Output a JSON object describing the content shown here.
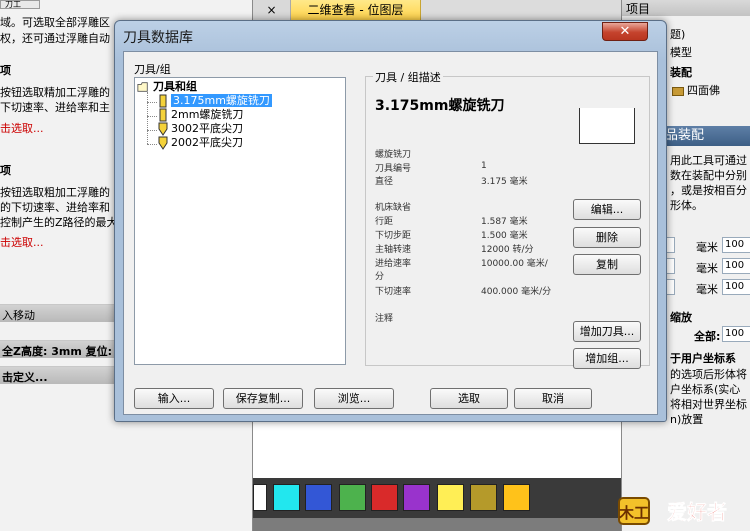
{
  "left_panel": {
    "top_button": "刀工",
    "lines": [
      {
        "text": "域。可选取全部浮雕区",
        "style": ""
      },
      {
        "text": "权，还可通过浮雕自动",
        "style": ""
      },
      {
        "text": "项",
        "style": "bold"
      },
      {
        "text": "按钮选取精加工浮雕的",
        "style": ""
      },
      {
        "text": "下切速率、进给率和主",
        "style": ""
      },
      {
        "text": "击选取...",
        "style": "red"
      },
      {
        "text": "项",
        "style": "bold"
      },
      {
        "text": "按钮选取粗加工浮雕的",
        "style": ""
      },
      {
        "text": "的下切速率、进给率和",
        "style": ""
      },
      {
        "text": "控制产生的Z路径的最大",
        "style": ""
      },
      {
        "text": "击选取...",
        "style": "red"
      }
    ],
    "bars": [
      "入移动",
      "全Z高度: 3mm 复位: X:",
      "击定义..."
    ]
  },
  "tabstrip": {
    "close_glyph": "×",
    "active_tab": "二维查看 - 位图层"
  },
  "palette": {
    "colors": [
      "#ffffff",
      "#22e7ee",
      "#3357d6",
      "#4db24d",
      "#d92a2a",
      "#9933cc",
      "#ffee55",
      "#b59a2a",
      "#ffc21a"
    ]
  },
  "right_panel": {
    "header": "项目",
    "tree_lines": [
      "题)",
      "模型",
      "装配",
      "四面佛"
    ],
    "section_title": "刚 - 成品装配",
    "desc_lines": [
      "用此工具可通过",
      "数在装配中分别",
      "，或是按相百分",
      "形体。"
    ],
    "unit_rows": [
      {
        "label": "毫米",
        "value": "100"
      },
      {
        "label": "毫米",
        "value": "100"
      },
      {
        "label": "毫米",
        "value": "100"
      }
    ],
    "scale_label": "缩放",
    "all_label": "全部:",
    "all_value": "100",
    "ucs_lines": [
      "于用户坐标系",
      "的选项后形体将",
      "户坐标系(实心",
      "将相对世界坐标",
      "n)放置"
    ],
    "logo_text": "爱好者",
    "logo_prefix": "木工"
  },
  "dialog": {
    "title": "刀具数据库",
    "close_glyph": "✕",
    "tools_group_label": "刀具/组",
    "desc_group_label": "刀具 / 组描述",
    "tree": {
      "root": "刀具和组",
      "items": [
        "3.175mm螺旋铣刀",
        "2mm螺旋铣刀",
        "3002平底尖刀",
        "2002平底尖刀"
      ],
      "selected_index": 0
    },
    "description": {
      "title": "3.175mm螺旋铣刀",
      "type": "螺旋铣刀",
      "props_a": [
        {
          "label": "刀具编号",
          "value": "1"
        },
        {
          "label": "直径",
          "value": "3.175 毫米"
        }
      ],
      "material": "机床缺省",
      "props_b": [
        {
          "label": "行距",
          "value": "1.587 毫米"
        },
        {
          "label": "下切步距",
          "value": "1.500 毫米"
        },
        {
          "label": "主轴转速",
          "value": "12000 转/分"
        },
        {
          "label": "进给速率",
          "value": "10000.00 毫米/"
        }
      ],
      "feed_wrap": "分",
      "plunge": {
        "label": "下切速率",
        "value": "400.000 毫米/分"
      },
      "notes_label": "注释"
    },
    "side_buttons": [
      "编辑...",
      "删除",
      "复制"
    ],
    "add_tool_button": "增加刀具...",
    "add_group_button": "增加组...",
    "bottom_buttons": {
      "import": "输入...",
      "save_copy": "保存复制...",
      "browse": "浏览...",
      "select": "选取",
      "cancel": "取消"
    }
  }
}
